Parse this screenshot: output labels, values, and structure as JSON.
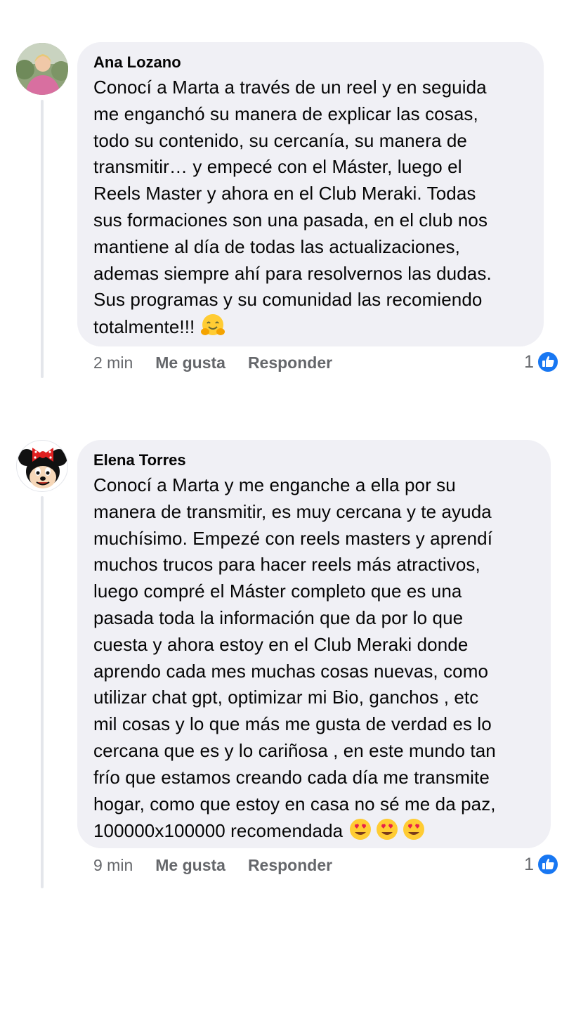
{
  "comments": [
    {
      "author": "Ana Lozano",
      "text": "Conocí a Marta a través de un reel y en seguida\nme enganchó su manera de explicar las cosas,\ntodo su contenido, su cercanía, su manera de\ntransmitir… y empecé con el Máster, luego el\nReels Master y ahora en el Club Meraki. Todas\nsus formaciones son una pasada, en el club nos\nmantiene al día de todas las actualizaciones,\nademas siempre ahí para resolvernos las dudas.\nSus programas y su comunidad las recomiendo\ntotalmente!!! ",
      "emoji": "hugging-face-icon",
      "time": "2 min",
      "like_label": "Me gusta",
      "reply_label": "Responder",
      "like_count": "1"
    },
    {
      "author": "Elena Torres",
      "text": "Conocí a Marta y me enganche a ella por su\nmanera de transmitir, es muy cercana y te ayuda\nmuchísimo. Empezé con reels masters y aprendí\nmuchos trucos para hacer reels más atractivos,\nluego compré el Máster completo que es una\npasada toda la información que da por lo que\ncuesta y ahora estoy en el Club Meraki donde\naprendo cada mes muchas cosas nuevas, como\nutilizar chat gpt, optimizar mi Bio, ganchos , etc\nmil cosas y lo que más me gusta de verdad es lo\ncercana que es y lo cariñosa , en este mundo tan\nfrío que estamos creando cada día me transmite\nhogar, como que estoy en casa no sé me da paz,\n100000x100000 recomendada ",
      "emoji": "heart-eyes-icon",
      "time": "9 min",
      "like_label": "Me gusta",
      "reply_label": "Responder",
      "like_count": "1"
    }
  ],
  "colors": {
    "bubble": "#f0f0f5",
    "meta_text": "#65676b",
    "like_blue": "#1877f2"
  }
}
